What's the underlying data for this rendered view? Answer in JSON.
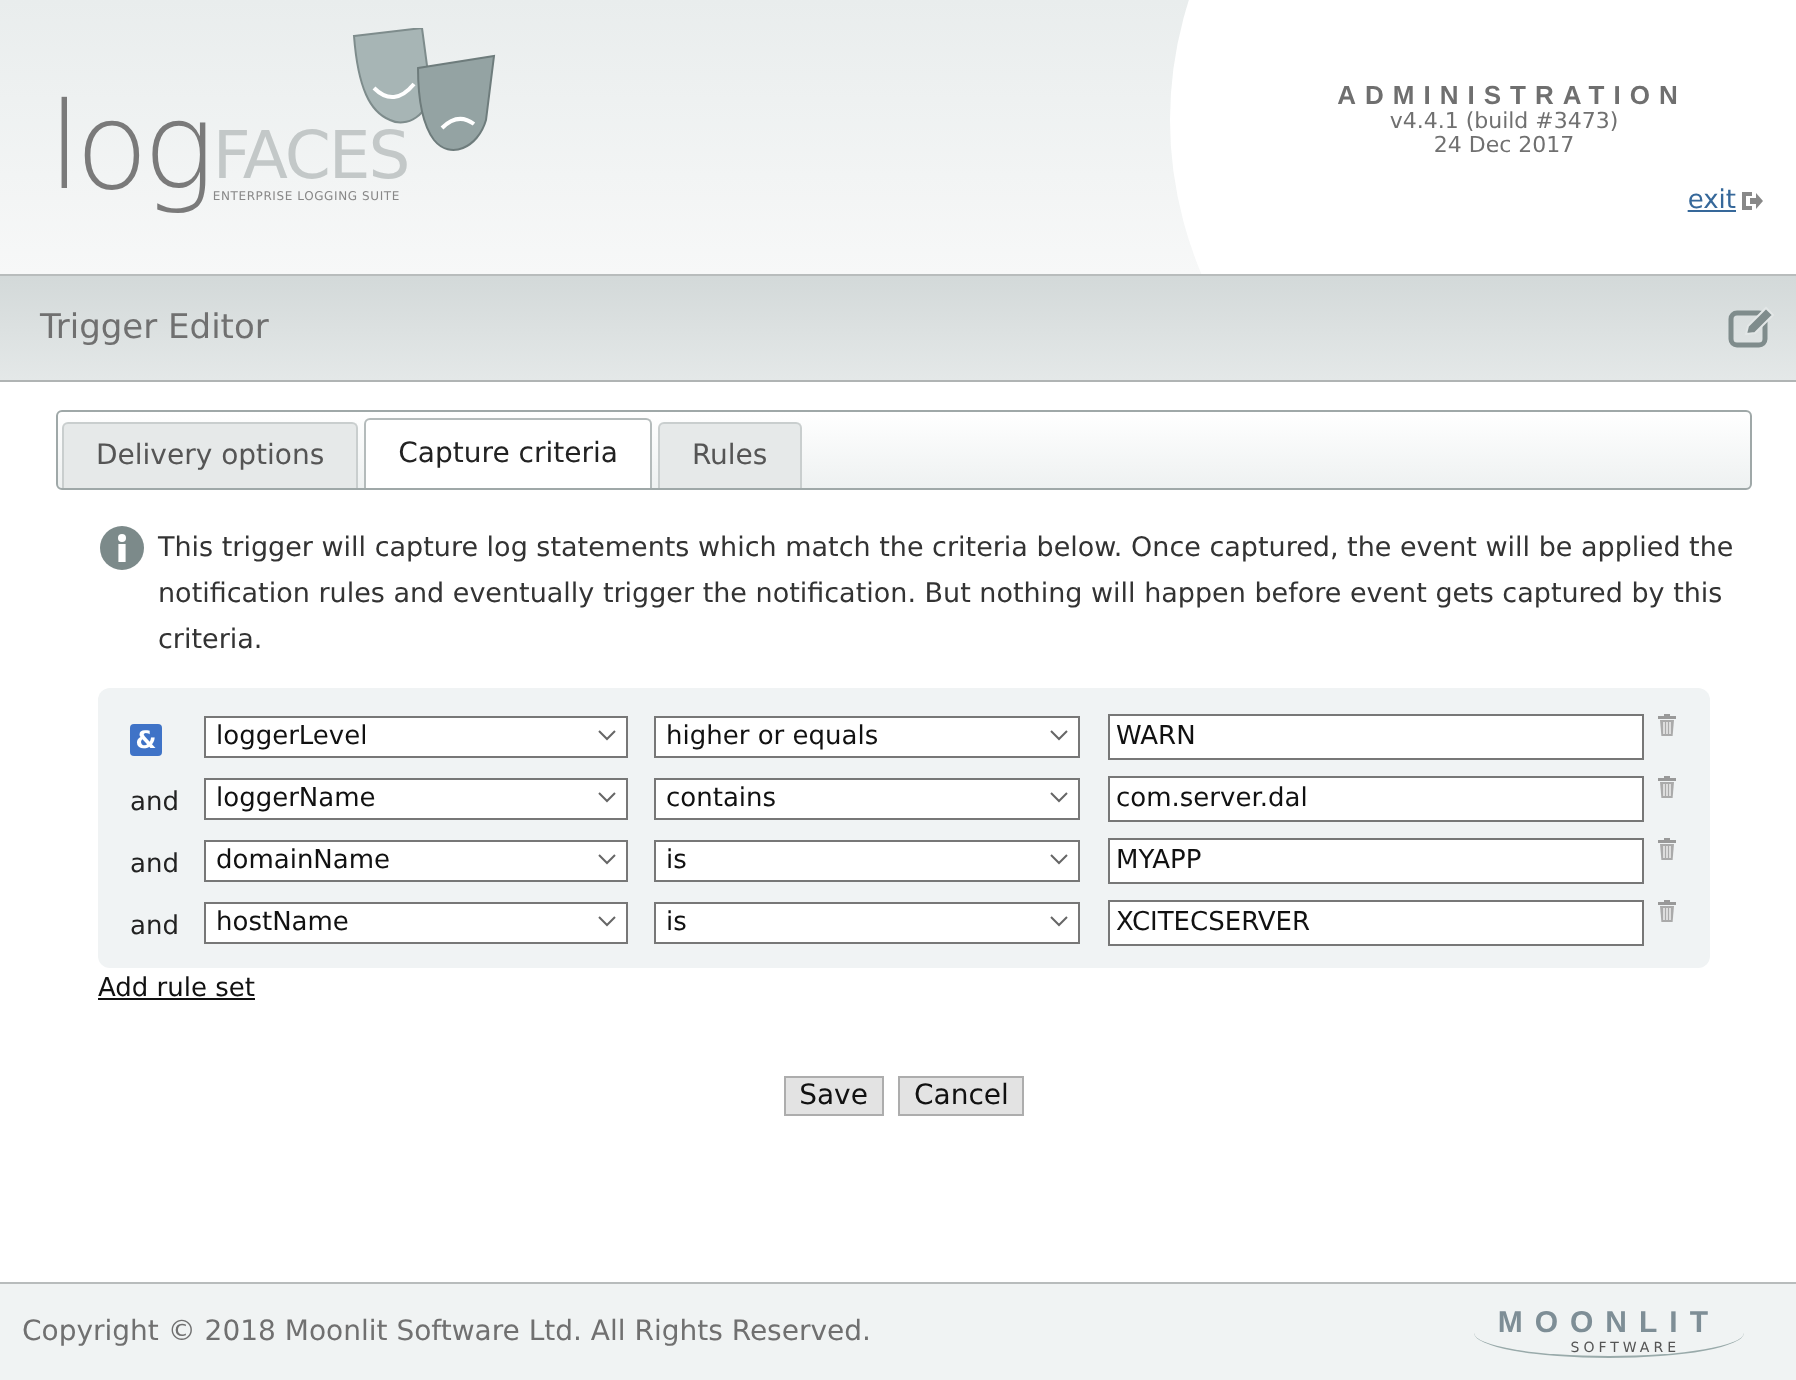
{
  "header": {
    "logo": {
      "word": "log",
      "brand": "FACES",
      "tagline": "ENTERPRISE LOGGING SUITE"
    },
    "section": "ADMINISTRATION",
    "version": "v4.4.1 (build #3473)",
    "date": "24 Dec 2017",
    "exit_link": "exit"
  },
  "title_bar": {
    "title": "Trigger Editor"
  },
  "tabs": [
    {
      "label": "Delivery options",
      "selected": false
    },
    {
      "label": "Capture criteria",
      "selected": true
    },
    {
      "label": "Rules",
      "selected": false
    }
  ],
  "info_text": "This trigger will capture log statements which match the criteria below. Once captured, the event will be applied the notification rules and eventually trigger the notification. But nothing will happen before event gets captured by this criteria.",
  "rules": [
    {
      "kind": "badge",
      "connector": "&",
      "field": "loggerLevel",
      "operator": "higher or equals",
      "value": "WARN"
    },
    {
      "kind": "plain",
      "connector": "and",
      "field": "loggerName",
      "operator": "contains",
      "value": "com.server.dal"
    },
    {
      "kind": "plain",
      "connector": "and",
      "field": "domainName",
      "operator": "is",
      "value": "MYAPP"
    },
    {
      "kind": "plain",
      "connector": "and",
      "field": "hostName",
      "operator": "is",
      "value": "XCITECSERVER"
    }
  ],
  "add_rule_set": "Add rule set",
  "buttons": [
    "Save",
    "Cancel"
  ],
  "footer": {
    "copyright": "Copyright © 2018 Moonlit Software Ltd. All Rights Reserved.",
    "logo": {
      "word": "MOONLIT",
      "sub": "SOFTWARE"
    }
  }
}
